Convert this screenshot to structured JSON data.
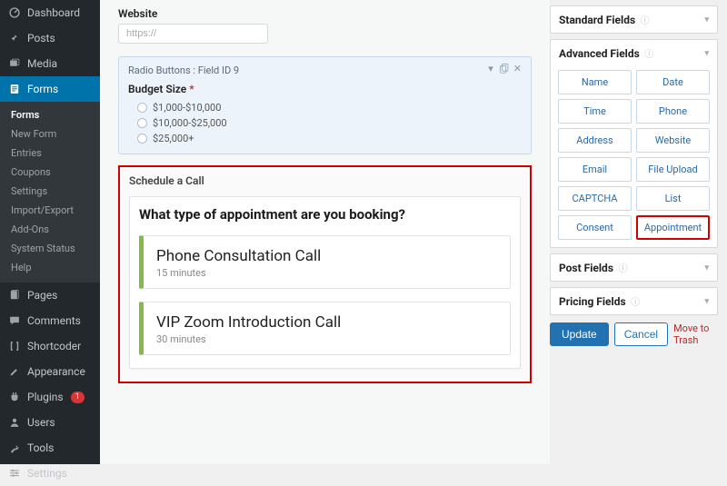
{
  "sidebar": {
    "items": [
      {
        "label": "Dashboard"
      },
      {
        "label": "Posts"
      },
      {
        "label": "Media"
      },
      {
        "label": "Forms"
      },
      {
        "label": "Pages"
      },
      {
        "label": "Comments"
      },
      {
        "label": "Shortcoder"
      },
      {
        "label": "Appearance"
      },
      {
        "label": "Plugins",
        "badge": "1"
      },
      {
        "label": "Users"
      },
      {
        "label": "Tools"
      },
      {
        "label": "Settings"
      }
    ],
    "forms_sub": [
      "Forms",
      "New Form",
      "Entries",
      "Coupons",
      "Settings",
      "Import/Export",
      "Add-Ons",
      "System Status",
      "Help"
    ]
  },
  "editor": {
    "website_label": "Website",
    "website_placeholder": "https://",
    "radio_field": {
      "header": "Radio Buttons : Field ID 9",
      "title": "Budget Size",
      "options": [
        "$1,000-$10,000",
        "$10,000-$25,000",
        "$25,000+"
      ]
    },
    "schedule_label": "Schedule a Call",
    "appt_question": "What type of appointment are you booking?",
    "appt_options": [
      {
        "name": "Phone Consultation Call",
        "duration": "15 minutes"
      },
      {
        "name": "VIP Zoom Introduction Call",
        "duration": "30 minutes"
      }
    ]
  },
  "rside": {
    "panels": {
      "standard": "Standard Fields",
      "advanced": "Advanced Fields",
      "post": "Post Fields",
      "pricing": "Pricing Fields"
    },
    "advanced_buttons": [
      "Name",
      "Date",
      "Time",
      "Phone",
      "Address",
      "Website",
      "Email",
      "File Upload",
      "CAPTCHA",
      "List",
      "Consent",
      "Appointment"
    ],
    "update": "Update",
    "cancel": "Cancel",
    "trash": "Move to Trash"
  }
}
